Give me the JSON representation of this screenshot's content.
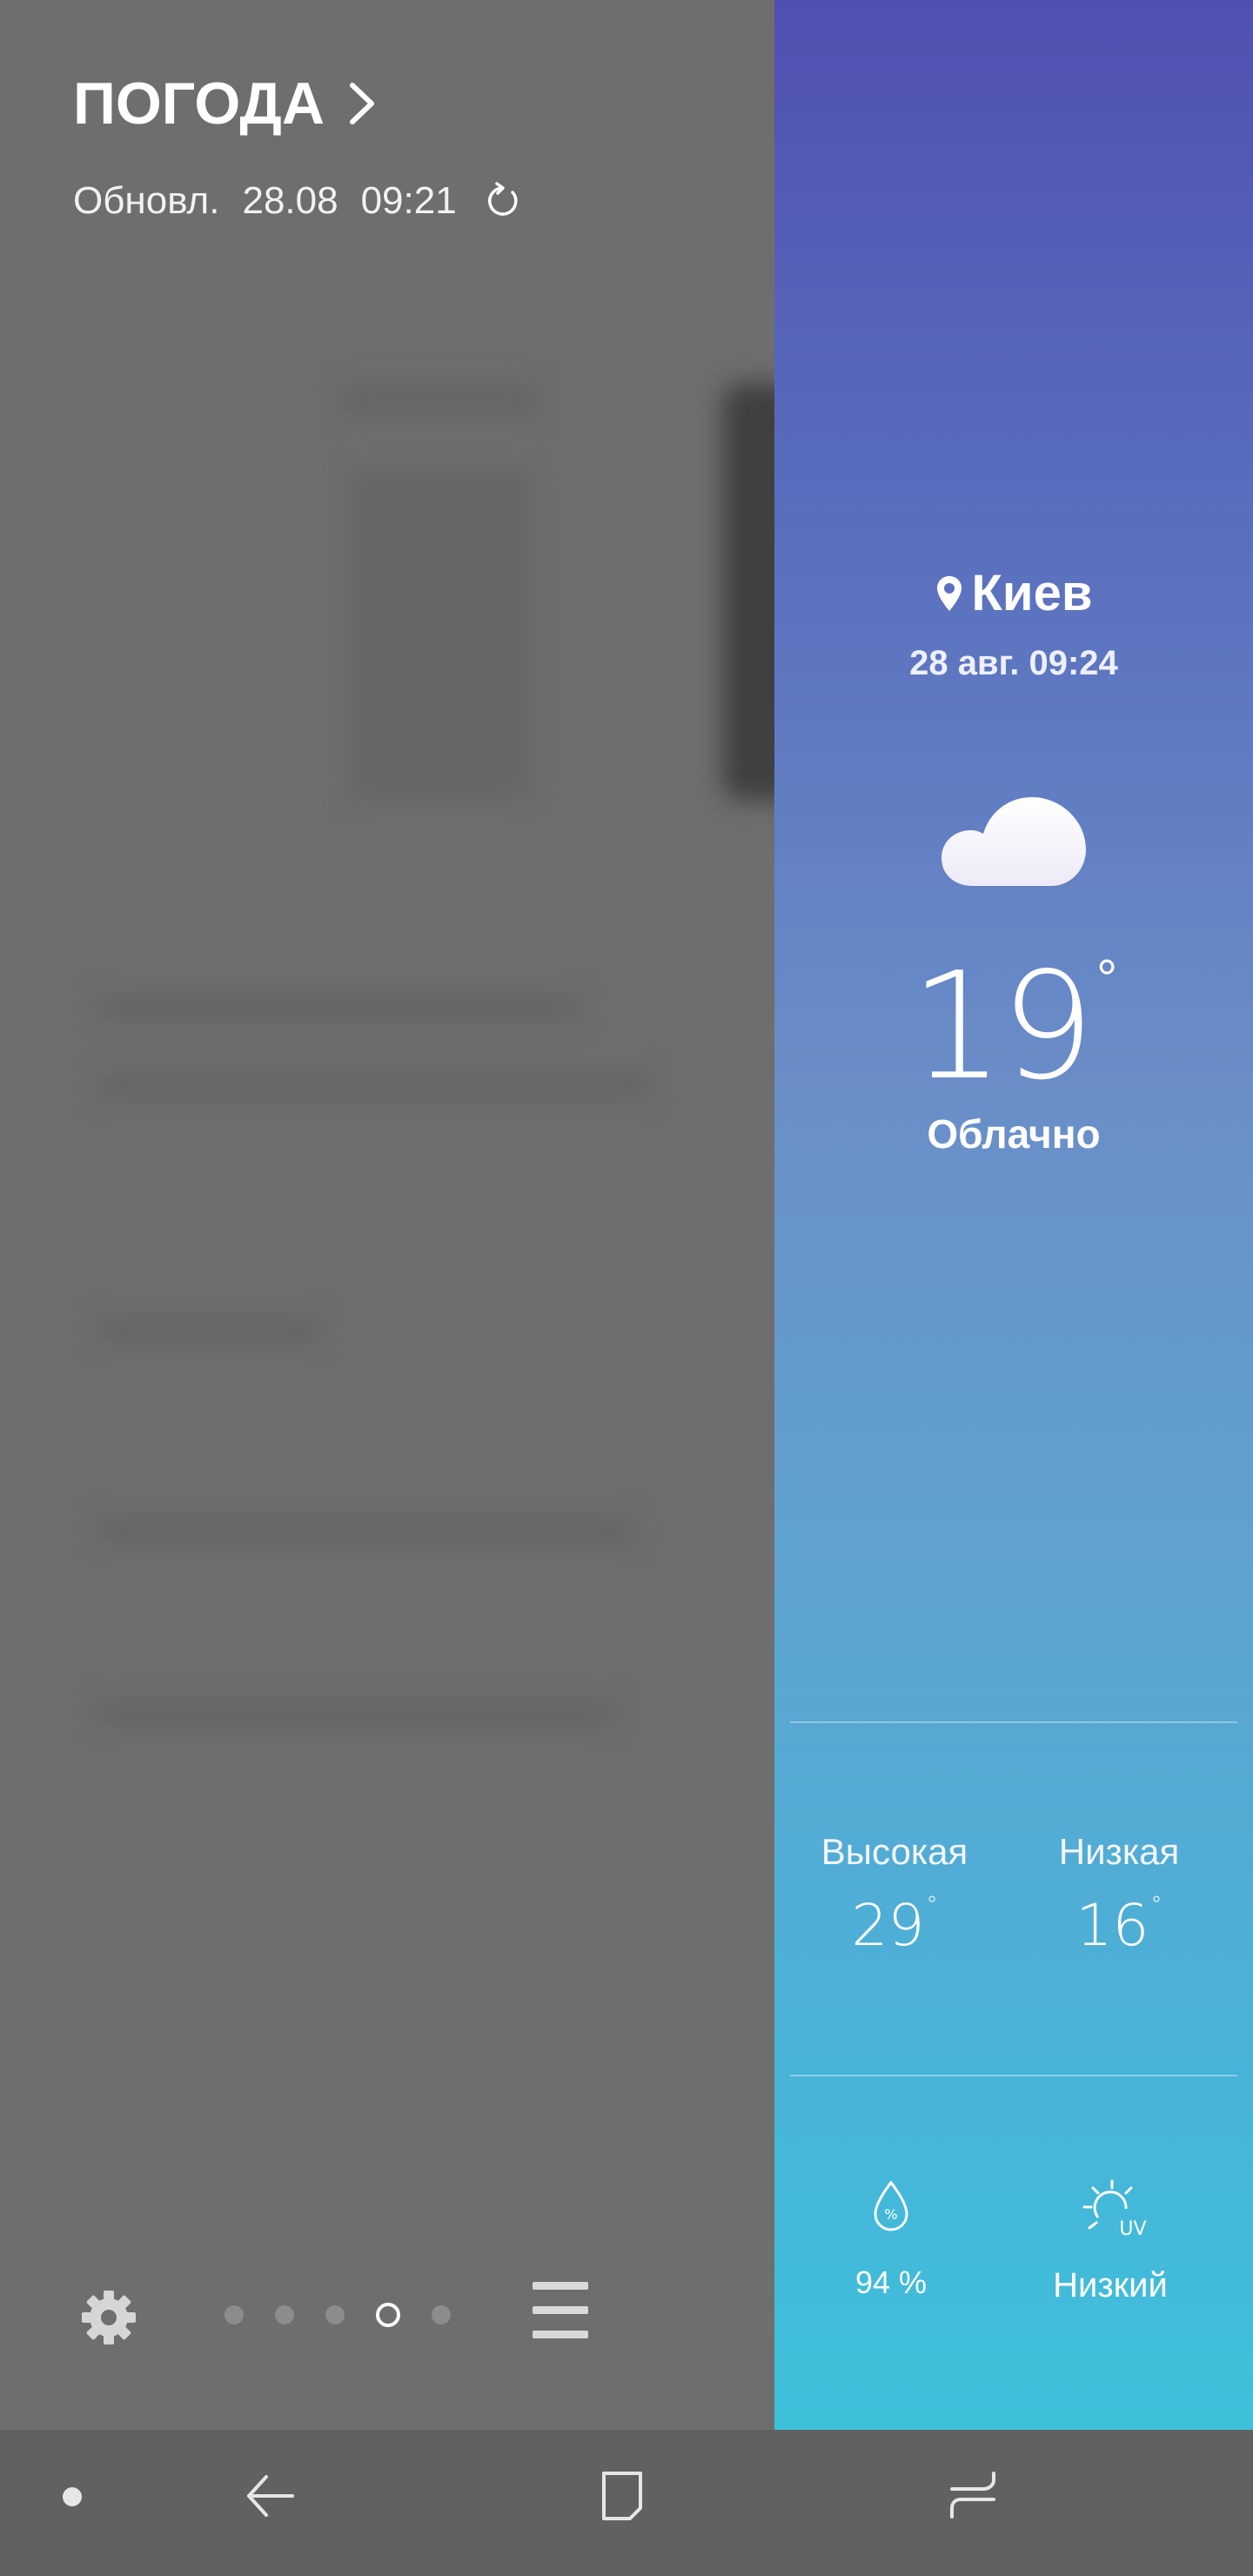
{
  "panel": {
    "title": "ПОГОДА",
    "updated_label": "Обновл.",
    "updated_date": "28.08",
    "updated_time": "09:21",
    "page_dots_count": 5,
    "active_page_index": 3
  },
  "weather": {
    "city": "Киев",
    "datetime": "28 авг. 09:24",
    "temperature": "19",
    "degree_symbol": "°",
    "condition": "Облачно",
    "icon": "cloud-icon",
    "high_label": "Высокая",
    "high_value": "29",
    "low_label": "Низкая",
    "low_value": "16",
    "humidity_value": "94 %",
    "uv_label": "Низкий",
    "colors": {
      "gradient_top": "#5050b0",
      "gradient_bottom": "#3ec0db"
    }
  },
  "navigation": {
    "icons": [
      "nav-dot",
      "back-icon",
      "home-icon",
      "recents-icon"
    ]
  }
}
